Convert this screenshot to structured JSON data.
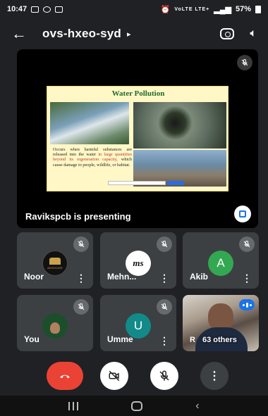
{
  "status_bar": {
    "time": "10:47",
    "network": "VoLTE LTE+",
    "battery": "57%"
  },
  "app_bar": {
    "meeting_code": "ovs-hxeo-syd"
  },
  "presentation": {
    "slide_title": "Water Pollution",
    "slide_text_a": "Occurs when harmful substances are released into the water",
    "slide_text_red": "in large quantities beyond its regeneration capacity,",
    "slide_text_b": "which cause damage to people, wildlife, or habitat.",
    "label": "Ravikspcb is presenting"
  },
  "participants": [
    {
      "name": "Noor",
      "avatar_text": "ADVOCATE",
      "muted": true
    },
    {
      "name": "Mehn...",
      "avatar_text": "ms",
      "muted": true
    },
    {
      "name": "Akib",
      "avatar_text": "A",
      "muted": true
    },
    {
      "name": "You",
      "avatar_text": "",
      "muted": true
    },
    {
      "name": "Umme",
      "avatar_text": "U",
      "muted": true
    }
  ],
  "others": {
    "initial": "R",
    "label": "63 others"
  },
  "colors": {
    "background": "#202124",
    "tile": "#3c4043",
    "end_call": "#ea4335",
    "accent": "#1a73e8",
    "akib_avatar": "#33a852",
    "umme_avatar": "#128a8a"
  }
}
